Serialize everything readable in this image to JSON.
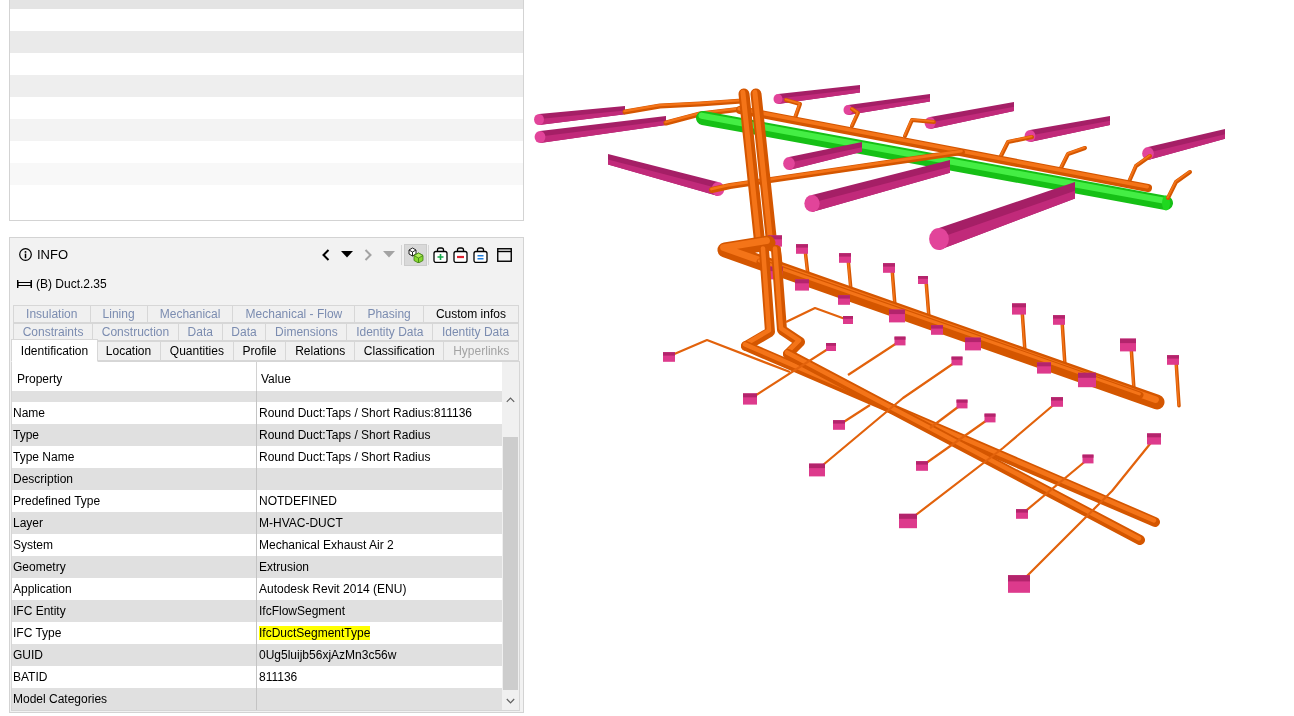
{
  "info_panel": {
    "title": "INFO",
    "toolbar": [
      {
        "kind": "back",
        "disabled": false,
        "pressed": false
      },
      {
        "kind": "history",
        "disabled": false,
        "pressed": false
      },
      {
        "kind": "forward",
        "disabled": true,
        "pressed": false
      },
      {
        "kind": "history",
        "disabled": true,
        "pressed": false
      },
      {
        "kind": "isolate",
        "disabled": false,
        "pressed": true
      },
      {
        "kind": "add",
        "disabled": false,
        "pressed": false
      },
      {
        "kind": "remove",
        "disabled": false,
        "pressed": false
      },
      {
        "kind": "equal",
        "disabled": false,
        "pressed": false
      },
      {
        "kind": "window",
        "disabled": false,
        "pressed": false
      }
    ],
    "selection": "(B) Duct.2.35",
    "tab_rows": [
      {
        "tabs": [
          {
            "label": "Insulation",
            "selected": false,
            "dimmed": true,
            "disabled": false
          },
          {
            "label": "Lining",
            "selected": false,
            "dimmed": true,
            "disabled": false
          },
          {
            "label": "Mechanical",
            "selected": false,
            "dimmed": true,
            "disabled": false
          },
          {
            "label": "Mechanical - Flow",
            "selected": false,
            "dimmed": true,
            "disabled": false
          },
          {
            "label": "Phasing",
            "selected": false,
            "dimmed": true,
            "disabled": false
          },
          {
            "label": "Custom infos",
            "selected": false,
            "dimmed": false,
            "disabled": false
          }
        ]
      },
      {
        "tabs": [
          {
            "label": "Constraints",
            "selected": false,
            "dimmed": true,
            "disabled": false
          },
          {
            "label": "Construction",
            "selected": false,
            "dimmed": true,
            "disabled": false
          },
          {
            "label": "Data",
            "selected": false,
            "dimmed": true,
            "disabled": false
          },
          {
            "label": "Data",
            "selected": false,
            "dimmed": true,
            "disabled": false
          },
          {
            "label": "Dimensions",
            "selected": false,
            "dimmed": true,
            "disabled": false
          },
          {
            "label": "Identity Data",
            "selected": false,
            "dimmed": true,
            "disabled": false
          },
          {
            "label": "Identity Data",
            "selected": false,
            "dimmed": true,
            "disabled": false
          }
        ]
      },
      {
        "tabs": [
          {
            "label": "Identification",
            "selected": true,
            "dimmed": false,
            "disabled": false
          },
          {
            "label": "Location",
            "selected": false,
            "dimmed": false,
            "disabled": false
          },
          {
            "label": "Quantities",
            "selected": false,
            "dimmed": false,
            "disabled": false
          },
          {
            "label": "Profile",
            "selected": false,
            "dimmed": false,
            "disabled": false
          },
          {
            "label": "Relations",
            "selected": false,
            "dimmed": false,
            "disabled": false
          },
          {
            "label": "Classification",
            "selected": false,
            "dimmed": false,
            "disabled": false
          },
          {
            "label": "Hyperlinks",
            "selected": false,
            "dimmed": false,
            "disabled": true
          }
        ]
      }
    ],
    "table": {
      "columns": [
        "Property",
        "Value"
      ],
      "rows": [
        {
          "property": "Name",
          "value": "Round Duct:Taps / Short Radius:811136",
          "highlighted": false
        },
        {
          "property": "Type",
          "value": "Round Duct:Taps / Short Radius",
          "highlighted": false
        },
        {
          "property": "Type Name",
          "value": "Round Duct:Taps / Short Radius",
          "highlighted": false
        },
        {
          "property": "Description",
          "highlighted": false
        },
        {
          "property": "Predefined Type",
          "value": "NOTDEFINED",
          "highlighted": false
        },
        {
          "property": "Layer",
          "value": "M-HVAC-DUCT",
          "highlighted": false
        },
        {
          "property": "System",
          "value": "Mechanical Exhaust Air 2",
          "highlighted": false
        },
        {
          "property": "Geometry",
          "value": "Extrusion",
          "highlighted": false
        },
        {
          "property": "Application",
          "value": "Autodesk Revit 2014 (ENU)",
          "highlighted": false
        },
        {
          "property": "IFC Entity",
          "value": "IfcFlowSegment",
          "highlighted": false
        },
        {
          "property": "IFC Type",
          "value": "IfcDuctSegmentType",
          "highlighted": true
        },
        {
          "property": "GUID",
          "value": "0Ug5luijb56xjAzMn3c56w",
          "highlighted": false
        },
        {
          "property": "BATID",
          "value": "811136",
          "highlighted": false
        },
        {
          "property": "Model Categories",
          "highlighted": false
        }
      ]
    }
  }
}
